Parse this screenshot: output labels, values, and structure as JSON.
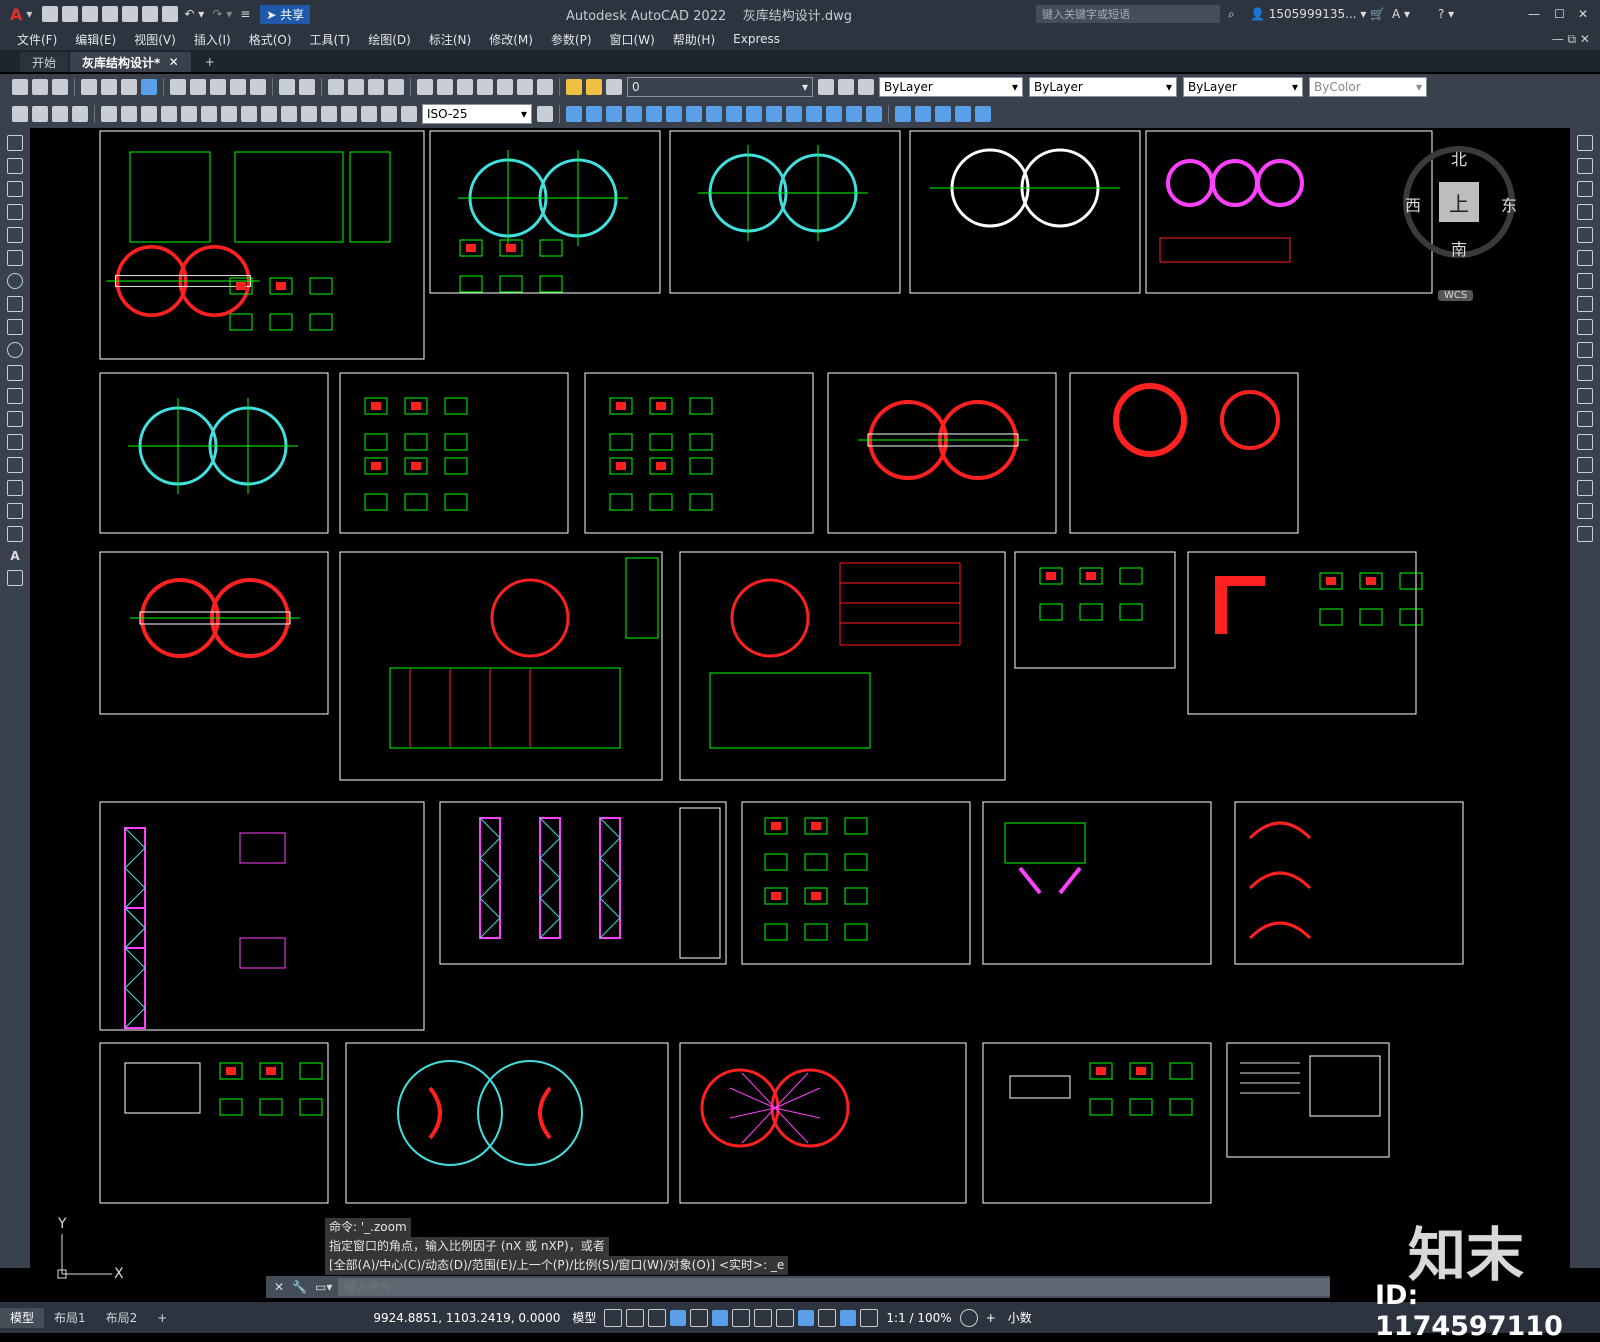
{
  "titlebar": {
    "app_title": "Autodesk AutoCAD 2022",
    "file_name": "灰库结构设计.dwg",
    "share_label": "共享",
    "search_placeholder": "键入关键字或短语",
    "user": "1505999135...",
    "app_icon": "A"
  },
  "menu": [
    "文件(F)",
    "编辑(E)",
    "视图(V)",
    "插入(I)",
    "格式(O)",
    "工具(T)",
    "绘图(D)",
    "标注(N)",
    "修改(M)",
    "参数(P)",
    "窗口(W)",
    "帮助(H)",
    "Express"
  ],
  "tabs": [
    {
      "label": "开始",
      "active": false
    },
    {
      "label": "灰库结构设计*",
      "active": true
    }
  ],
  "toolbar": {
    "layer_value": "0",
    "color_value": "ByLayer",
    "linetype_value": "ByLayer",
    "lineweight_value": "ByLayer",
    "plotstyle_value": "ByColor",
    "dimstyle_value": "ISO-25"
  },
  "viewcube": {
    "north": "北",
    "south": "南",
    "east": "东",
    "west": "西",
    "face": "上",
    "wcs": "WCS"
  },
  "ucs": {
    "x": "X",
    "y": "Y"
  },
  "command": {
    "history": [
      "命令: '_.zoom",
      "指定窗口的角点，输入比例因子 (nX 或 nXP)，或者",
      "[全部(A)/中心(C)/动态(D)/范围(E)/上一个(P)/比例(S)/窗口(W)/对象(O)] <实时>: _e"
    ],
    "placeholder": "键入命令"
  },
  "layout_tabs": [
    {
      "label": "模型",
      "active": true
    },
    {
      "label": "布局1",
      "active": false
    },
    {
      "label": "布局2",
      "active": false
    }
  ],
  "status": {
    "coords": "9924.8851, 1103.2419, 0.0000",
    "model": "模型",
    "scale": "1:1 / 100%",
    "units": "小数"
  },
  "watermark": {
    "brand": "知末",
    "id": "ID: 1174597110"
  },
  "colors": {
    "bg": "#000000",
    "panel": "#3a414c",
    "titlebar": "#2d3440",
    "green": "#00ff00",
    "red": "#ff2020",
    "cyan": "#40e0e0",
    "magenta": "#ff40ff"
  }
}
